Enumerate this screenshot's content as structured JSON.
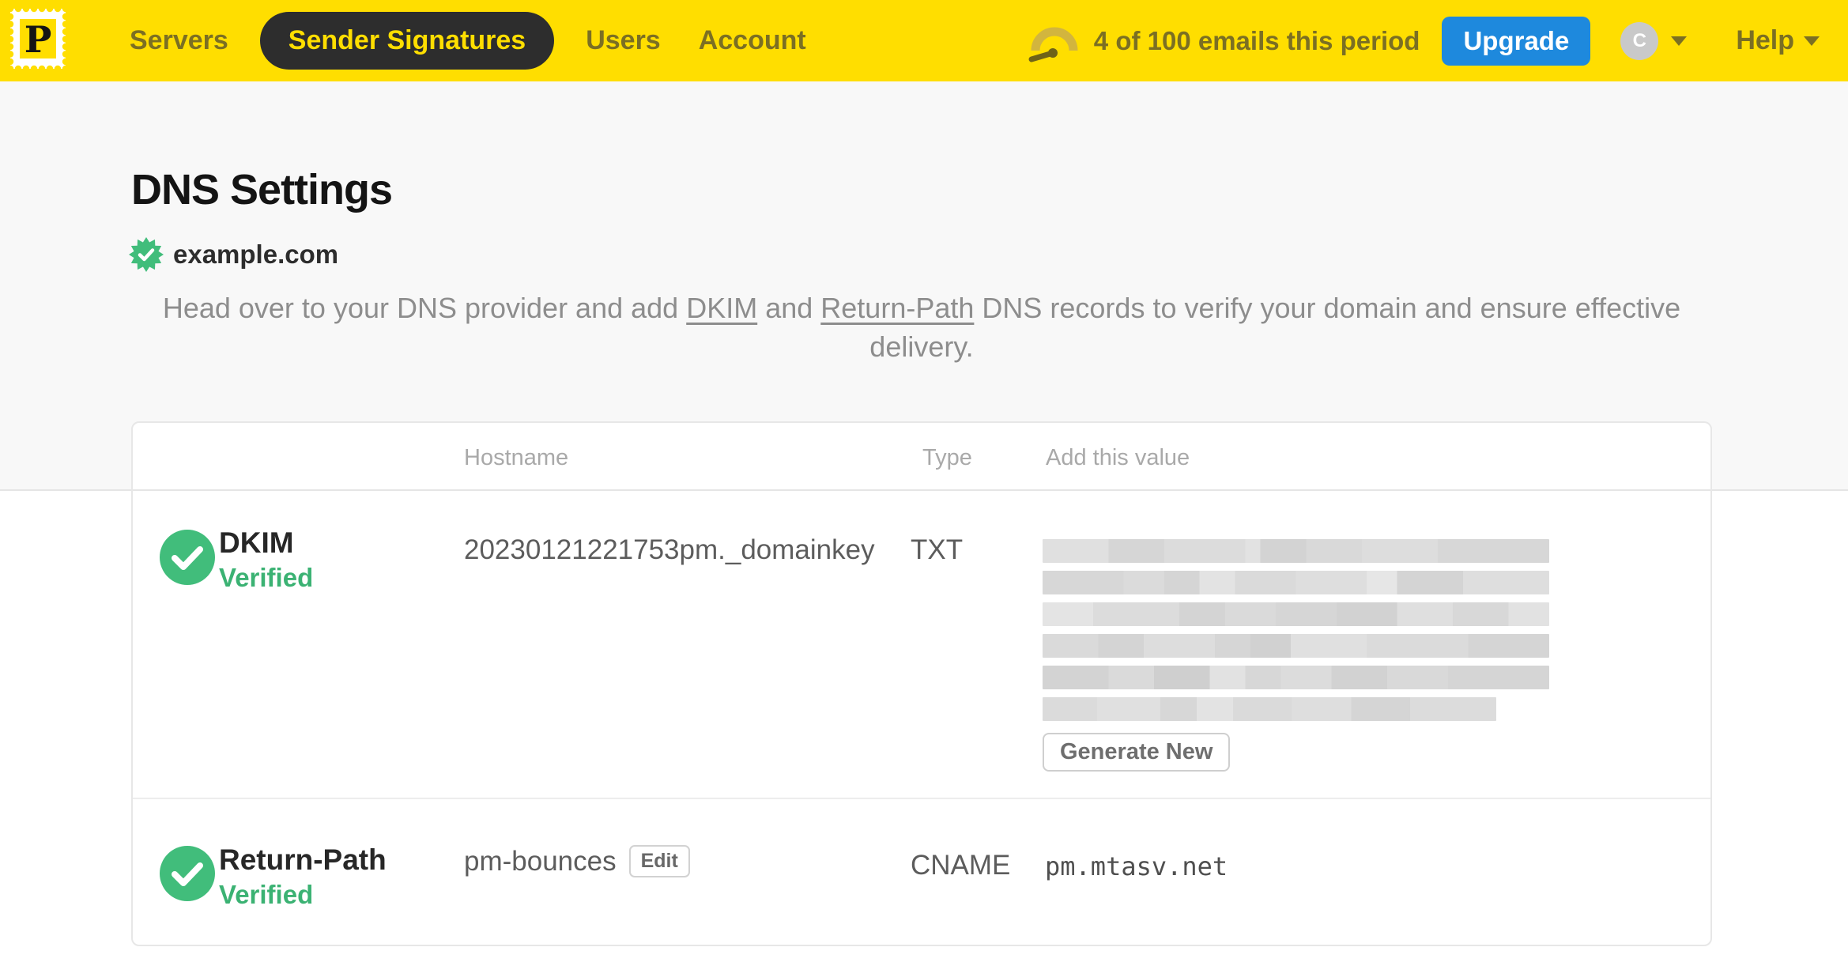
{
  "nav": {
    "logo_letter": "P",
    "items": [
      {
        "label": "Servers"
      },
      {
        "label": "Sender Signatures"
      },
      {
        "label": "Users"
      },
      {
        "label": "Account"
      }
    ],
    "usage_text": "4 of 100 emails this period",
    "upgrade_label": "Upgrade",
    "avatar_initial": "C",
    "help_label": "Help"
  },
  "page": {
    "title": "DNS Settings",
    "domain": "example.com",
    "intro": {
      "p1": "Head over to your DNS provider and add ",
      "link1": "DKIM",
      "p2": " and ",
      "link2": "Return-Path",
      "p3": " DNS records to verify your domain and ensure effective delivery."
    }
  },
  "table": {
    "headers": {
      "hostname": "Hostname",
      "type": "Type",
      "value": "Add this value"
    },
    "rows": [
      {
        "name": "DKIM",
        "status": "Verified",
        "hostname": "20230121221753pm._domainkey",
        "type": "TXT",
        "value_redacted": true,
        "action_label": "Generate New"
      },
      {
        "name": "Return-Path",
        "status": "Verified",
        "hostname": "pm-bounces",
        "edit_label": "Edit",
        "type": "CNAME",
        "value": "pm.mtasv.net"
      }
    ]
  },
  "colors": {
    "brand_yellow": "#FFDE00",
    "nav_text_olive": "#7b6f23",
    "active_pill_bg": "#2d2d2d",
    "upgrade_blue": "#1E89DD",
    "check_circle_green": "#41BD7B",
    "verified_text_green": "#3BB273",
    "page_bg_top": "#f8f8f8",
    "page_bg_bottom": "#ffffff"
  }
}
